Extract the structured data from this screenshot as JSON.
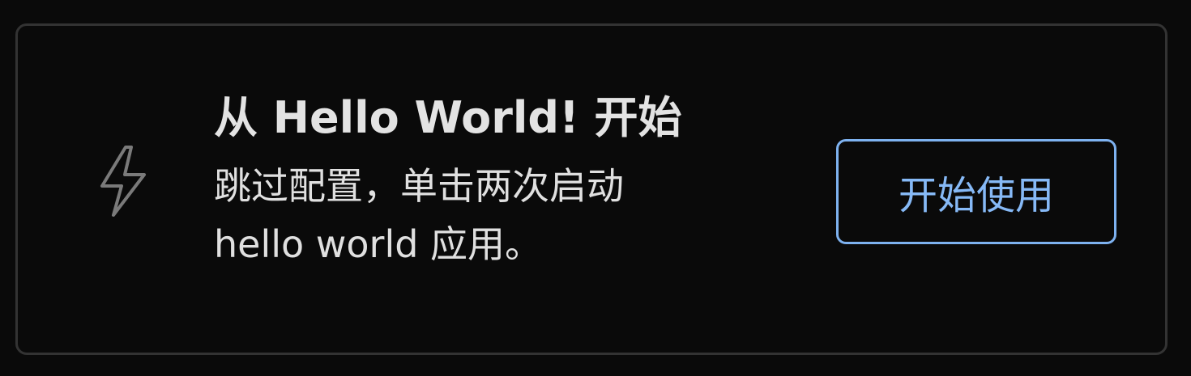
{
  "card": {
    "title": "从 Hello World! 开始",
    "description_line1": "跳过配置，单击两次启动",
    "description_line2": "hello world 应用。",
    "icon": "lightning-icon",
    "button_label": "开始使用"
  },
  "colors": {
    "background": "#0a0a0a",
    "card_border": "#333333",
    "text": "#e3e3e3",
    "icon": "#7a7a7a",
    "button_accent": "#86b9f6"
  }
}
